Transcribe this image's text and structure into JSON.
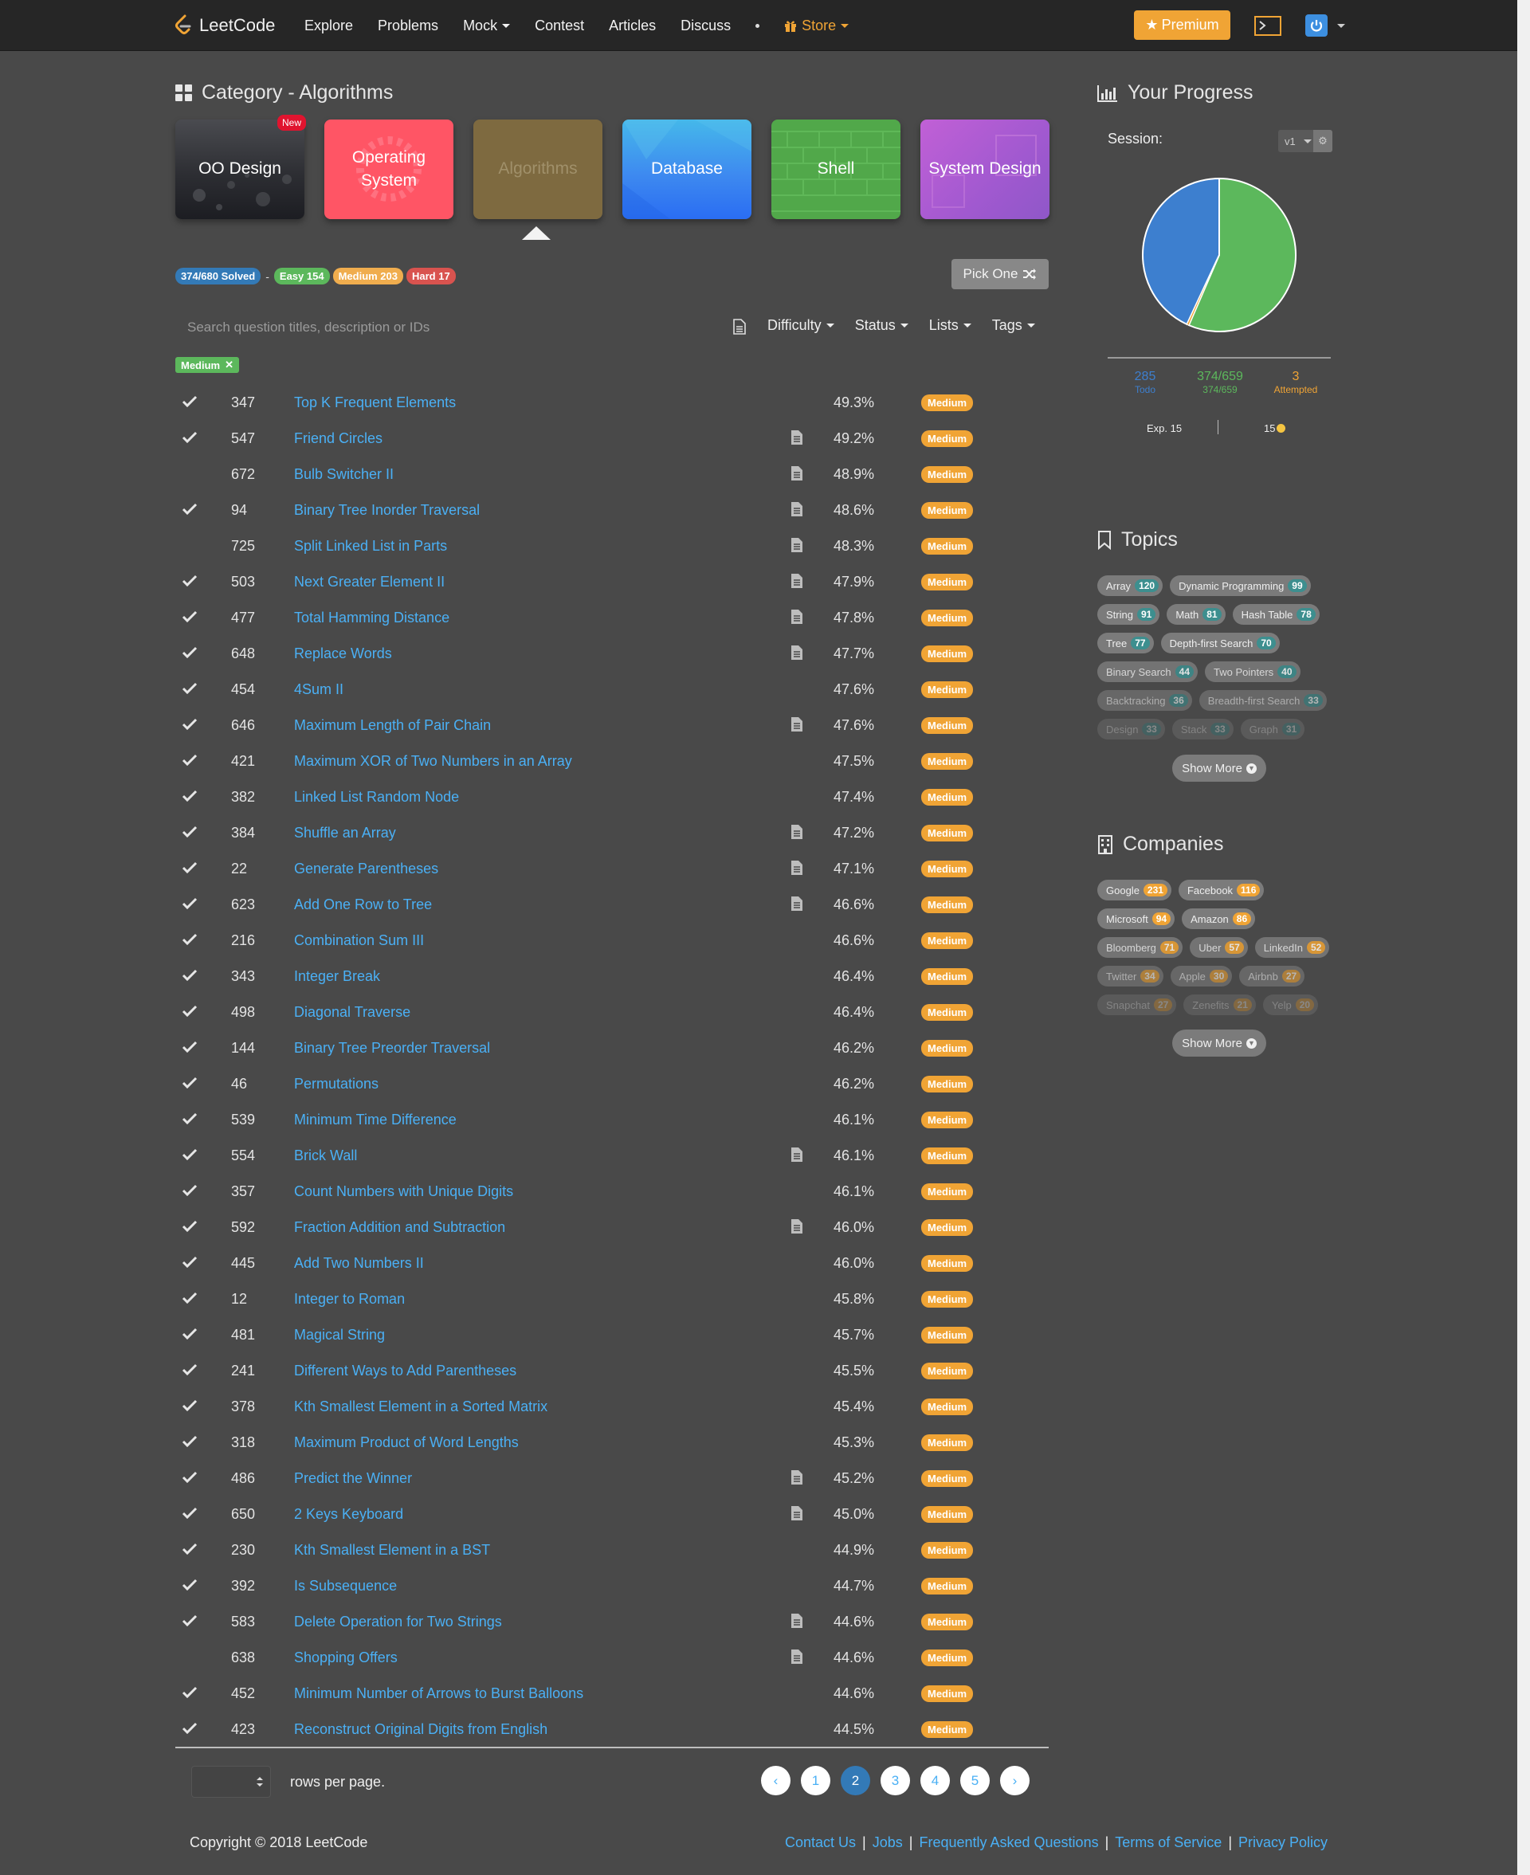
{
  "nav": {
    "logo_text": "LeetCode",
    "items": [
      "Explore",
      "Problems",
      "Mock",
      "Contest",
      "Articles",
      "Discuss"
    ],
    "store": "Store",
    "premium": "Premium"
  },
  "category": {
    "title": "Category - Algorithms",
    "cards": [
      "OO Design",
      "Operating System",
      "Algorithms",
      "Database",
      "Shell",
      "System Design"
    ],
    "new_badge": "New"
  },
  "stats": {
    "solved": "374/680 Solved",
    "dash": "-",
    "easy": "Easy 154",
    "medium": "Medium 203",
    "hard": "Hard 17"
  },
  "pick_one": "Pick One",
  "search": {
    "placeholder": "Search question titles, description or IDs"
  },
  "filters": [
    "Difficulty",
    "Status",
    "Lists",
    "Tags"
  ],
  "active_tag": "Medium",
  "colors": {
    "link": "#4ab0f5",
    "medium": "#f0a435",
    "easy": "#5cb85c",
    "hard": "#d9534f",
    "solved_blue": "#337ab7"
  },
  "problems": [
    {
      "solved": true,
      "id": "347",
      "title": "Top K Frequent Elements",
      "solution": false,
      "acceptance": "49.3%",
      "difficulty": "Medium"
    },
    {
      "solved": true,
      "id": "547",
      "title": "Friend Circles",
      "solution": true,
      "acceptance": "49.2%",
      "difficulty": "Medium"
    },
    {
      "solved": false,
      "id": "672",
      "title": "Bulb Switcher II",
      "solution": true,
      "acceptance": "48.9%",
      "difficulty": "Medium"
    },
    {
      "solved": true,
      "id": "94",
      "title": "Binary Tree Inorder Traversal",
      "solution": true,
      "acceptance": "48.6%",
      "difficulty": "Medium"
    },
    {
      "solved": false,
      "id": "725",
      "title": "Split Linked List in Parts",
      "solution": true,
      "acceptance": "48.3%",
      "difficulty": "Medium"
    },
    {
      "solved": true,
      "id": "503",
      "title": "Next Greater Element II",
      "solution": true,
      "acceptance": "47.9%",
      "difficulty": "Medium"
    },
    {
      "solved": true,
      "id": "477",
      "title": "Total Hamming Distance",
      "solution": true,
      "acceptance": "47.8%",
      "difficulty": "Medium"
    },
    {
      "solved": true,
      "id": "648",
      "title": "Replace Words",
      "solution": true,
      "acceptance": "47.7%",
      "difficulty": "Medium"
    },
    {
      "solved": true,
      "id": "454",
      "title": "4Sum II",
      "solution": false,
      "acceptance": "47.6%",
      "difficulty": "Medium"
    },
    {
      "solved": true,
      "id": "646",
      "title": "Maximum Length of Pair Chain",
      "solution": true,
      "acceptance": "47.6%",
      "difficulty": "Medium"
    },
    {
      "solved": true,
      "id": "421",
      "title": "Maximum XOR of Two Numbers in an Array",
      "solution": false,
      "acceptance": "47.5%",
      "difficulty": "Medium"
    },
    {
      "solved": true,
      "id": "382",
      "title": "Linked List Random Node",
      "solution": false,
      "acceptance": "47.4%",
      "difficulty": "Medium"
    },
    {
      "solved": true,
      "id": "384",
      "title": "Shuffle an Array",
      "solution": true,
      "acceptance": "47.2%",
      "difficulty": "Medium"
    },
    {
      "solved": true,
      "id": "22",
      "title": "Generate Parentheses",
      "solution": true,
      "acceptance": "47.1%",
      "difficulty": "Medium"
    },
    {
      "solved": true,
      "id": "623",
      "title": "Add One Row to Tree",
      "solution": true,
      "acceptance": "46.6%",
      "difficulty": "Medium"
    },
    {
      "solved": true,
      "id": "216",
      "title": "Combination Sum III",
      "solution": false,
      "acceptance": "46.6%",
      "difficulty": "Medium"
    },
    {
      "solved": true,
      "id": "343",
      "title": "Integer Break",
      "solution": false,
      "acceptance": "46.4%",
      "difficulty": "Medium"
    },
    {
      "solved": true,
      "id": "498",
      "title": "Diagonal Traverse",
      "solution": false,
      "acceptance": "46.4%",
      "difficulty": "Medium"
    },
    {
      "solved": true,
      "id": "144",
      "title": "Binary Tree Preorder Traversal",
      "solution": false,
      "acceptance": "46.2%",
      "difficulty": "Medium"
    },
    {
      "solved": true,
      "id": "46",
      "title": "Permutations",
      "solution": false,
      "acceptance": "46.2%",
      "difficulty": "Medium"
    },
    {
      "solved": true,
      "id": "539",
      "title": "Minimum Time Difference",
      "solution": false,
      "acceptance": "46.1%",
      "difficulty": "Medium"
    },
    {
      "solved": true,
      "id": "554",
      "title": "Brick Wall",
      "solution": true,
      "acceptance": "46.1%",
      "difficulty": "Medium"
    },
    {
      "solved": true,
      "id": "357",
      "title": "Count Numbers with Unique Digits",
      "solution": false,
      "acceptance": "46.1%",
      "difficulty": "Medium"
    },
    {
      "solved": true,
      "id": "592",
      "title": "Fraction Addition and Subtraction",
      "solution": true,
      "acceptance": "46.0%",
      "difficulty": "Medium"
    },
    {
      "solved": true,
      "id": "445",
      "title": "Add Two Numbers II",
      "solution": false,
      "acceptance": "46.0%",
      "difficulty": "Medium"
    },
    {
      "solved": true,
      "id": "12",
      "title": "Integer to Roman",
      "solution": false,
      "acceptance": "45.8%",
      "difficulty": "Medium"
    },
    {
      "solved": true,
      "id": "481",
      "title": "Magical String",
      "solution": false,
      "acceptance": "45.7%",
      "difficulty": "Medium"
    },
    {
      "solved": true,
      "id": "241",
      "title": "Different Ways to Add Parentheses",
      "solution": false,
      "acceptance": "45.5%",
      "difficulty": "Medium"
    },
    {
      "solved": true,
      "id": "378",
      "title": "Kth Smallest Element in a Sorted Matrix",
      "solution": false,
      "acceptance": "45.4%",
      "difficulty": "Medium"
    },
    {
      "solved": true,
      "id": "318",
      "title": "Maximum Product of Word Lengths",
      "solution": false,
      "acceptance": "45.3%",
      "difficulty": "Medium"
    },
    {
      "solved": true,
      "id": "486",
      "title": "Predict the Winner",
      "solution": true,
      "acceptance": "45.2%",
      "difficulty": "Medium"
    },
    {
      "solved": true,
      "id": "650",
      "title": "2 Keys Keyboard",
      "solution": true,
      "acceptance": "45.0%",
      "difficulty": "Medium"
    },
    {
      "solved": true,
      "id": "230",
      "title": "Kth Smallest Element in a BST",
      "solution": false,
      "acceptance": "44.9%",
      "difficulty": "Medium"
    },
    {
      "solved": true,
      "id": "392",
      "title": "Is Subsequence",
      "solution": false,
      "acceptance": "44.7%",
      "difficulty": "Medium"
    },
    {
      "solved": true,
      "id": "583",
      "title": "Delete Operation for Two Strings",
      "solution": true,
      "acceptance": "44.6%",
      "difficulty": "Medium"
    },
    {
      "solved": false,
      "id": "638",
      "title": "Shopping Offers",
      "solution": true,
      "acceptance": "44.6%",
      "difficulty": "Medium"
    },
    {
      "solved": true,
      "id": "452",
      "title": "Minimum Number of Arrows to Burst Balloons",
      "solution": false,
      "acceptance": "44.6%",
      "difficulty": "Medium"
    },
    {
      "solved": true,
      "id": "423",
      "title": "Reconstruct Original Digits from English",
      "solution": false,
      "acceptance": "44.5%",
      "difficulty": "Medium"
    }
  ],
  "pagination": {
    "rows_label": "rows per page.",
    "pages": [
      "1",
      "2",
      "3",
      "4",
      "5"
    ],
    "current": "2"
  },
  "footer": {
    "copyright": "Copyright © 2018 LeetCode",
    "links": [
      "Contact Us",
      "Jobs",
      "Frequently Asked Questions",
      "Terms of Service",
      "Privacy Policy"
    ],
    "separator": "|"
  },
  "progress": {
    "title": "Your Progress",
    "session_label": "Session:",
    "session_value": "v1",
    "todo_count": "285",
    "todo_label": "Todo",
    "solved_count": "374/659",
    "solved_sub": "374/659",
    "attempted_count": "3",
    "attempted_label": "Attempted",
    "exp": "Exp. 15",
    "coins": "15",
    "pie": {
      "solved": 374,
      "todo": 285,
      "attempted": 3
    }
  },
  "topics": {
    "title": "Topics",
    "show_more": "Show More",
    "rows": [
      [
        {
          "name": "Array",
          "count": "120"
        },
        {
          "name": "Dynamic Programming",
          "count": "99"
        }
      ],
      [
        {
          "name": "String",
          "count": "91"
        },
        {
          "name": "Math",
          "count": "81"
        },
        {
          "name": "Hash Table",
          "count": "78"
        }
      ],
      [
        {
          "name": "Tree",
          "count": "77"
        },
        {
          "name": "Depth-first Search",
          "count": "70"
        }
      ],
      [
        {
          "name": "Binary Search",
          "count": "44"
        },
        {
          "name": "Two Pointers",
          "count": "40"
        }
      ],
      [
        {
          "name": "Backtracking",
          "count": "36"
        },
        {
          "name": "Breadth-first Search",
          "count": "33"
        }
      ],
      [
        {
          "name": "Design",
          "count": "33"
        },
        {
          "name": "Stack",
          "count": "33"
        },
        {
          "name": "Graph",
          "count": "31"
        }
      ]
    ]
  },
  "companies": {
    "title": "Companies",
    "show_more": "Show More",
    "rows": [
      [
        {
          "name": "Google",
          "count": "231"
        },
        {
          "name": "Facebook",
          "count": "116"
        }
      ],
      [
        {
          "name": "Microsoft",
          "count": "94"
        },
        {
          "name": "Amazon",
          "count": "86"
        }
      ],
      [
        {
          "name": "Bloomberg",
          "count": "71"
        },
        {
          "name": "Uber",
          "count": "57"
        },
        {
          "name": "LinkedIn",
          "count": "52"
        }
      ],
      [
        {
          "name": "Twitter",
          "count": "34"
        },
        {
          "name": "Apple",
          "count": "30"
        },
        {
          "name": "Airbnb",
          "count": "27"
        }
      ],
      [
        {
          "name": "Snapchat",
          "count": "27"
        },
        {
          "name": "Zenefits",
          "count": "21"
        },
        {
          "name": "Yelp",
          "count": "20"
        }
      ]
    ]
  }
}
